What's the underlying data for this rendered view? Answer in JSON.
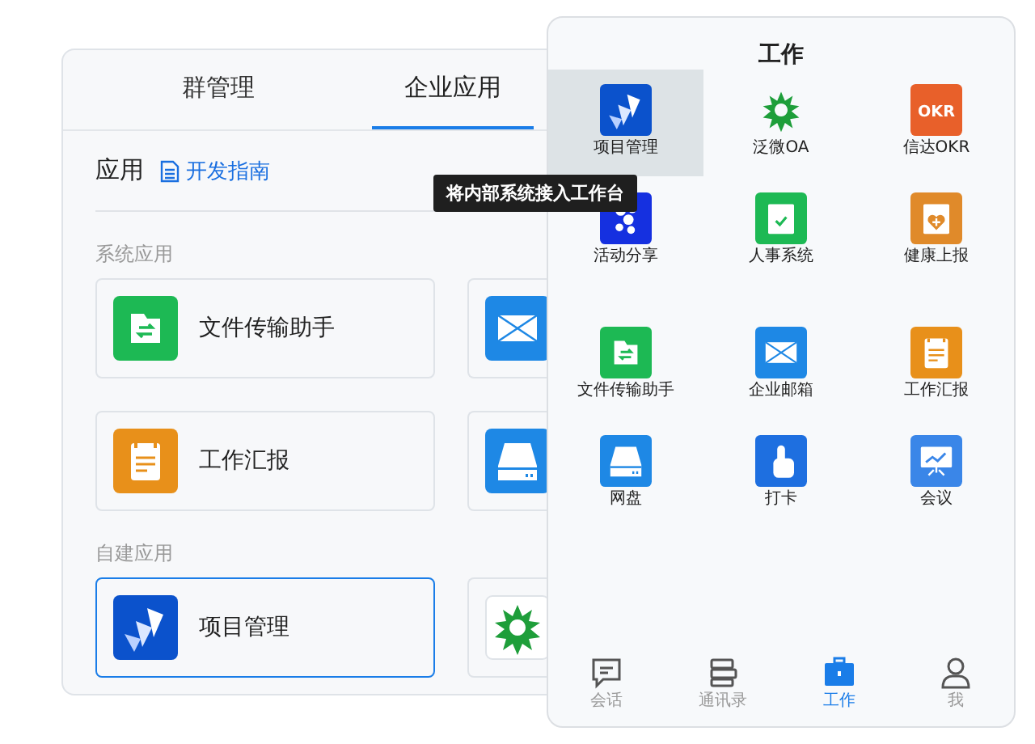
{
  "left_panel": {
    "tabs": [
      {
        "label": "群管理",
        "selected": false
      },
      {
        "label": "企业应用",
        "selected": true
      }
    ],
    "header": {
      "title": "应用",
      "link": "开发指南"
    },
    "sections": [
      {
        "title": "系统应用",
        "cards": [
          {
            "label": "文件传输助手",
            "kind": "file",
            "selected": false
          },
          {
            "kind": "mail",
            "selected": false
          },
          {
            "label": "工作汇报",
            "kind": "report",
            "selected": false
          },
          {
            "kind": "disk",
            "selected": false
          }
        ]
      },
      {
        "title": "自建应用",
        "cards": [
          {
            "label": "项目管理",
            "kind": "jira",
            "selected": true
          },
          {
            "kind": "oa",
            "selected": false
          }
        ]
      }
    ]
  },
  "tooltip": "将内部系统接入工作台",
  "phone": {
    "title": "工作",
    "sections": [
      [
        {
          "label": "项目管理",
          "kind": "jira",
          "highlighted": true
        },
        {
          "label": "泛微OA",
          "kind": "oa",
          "highlighted": false
        },
        {
          "label": "信达OKR",
          "kind": "okr",
          "badge_text": "OKR",
          "highlighted": false
        },
        {
          "label": "活动分享",
          "kind": "dots",
          "highlighted": false
        },
        {
          "label": "人事系统",
          "kind": "hr",
          "highlighted": false
        },
        {
          "label": "健康上报",
          "kind": "health",
          "highlighted": false
        }
      ],
      [
        {
          "label": "文件传输助手",
          "kind": "file",
          "highlighted": false
        },
        {
          "label": "企业邮箱",
          "kind": "mail",
          "highlighted": false
        },
        {
          "label": "工作汇报",
          "kind": "report",
          "highlighted": false
        },
        {
          "label": "网盘",
          "kind": "disk",
          "highlighted": false
        },
        {
          "label": "打卡",
          "kind": "tap",
          "highlighted": false
        },
        {
          "label": "会议",
          "kind": "meeting",
          "highlighted": false
        }
      ]
    ],
    "nav": [
      {
        "label": "会话",
        "kind": "chat",
        "selected": false
      },
      {
        "label": "通讯录",
        "kind": "contacts",
        "selected": false
      },
      {
        "label": "工作",
        "kind": "work",
        "selected": true
      },
      {
        "label": "我",
        "kind": "me",
        "selected": false
      }
    ]
  }
}
